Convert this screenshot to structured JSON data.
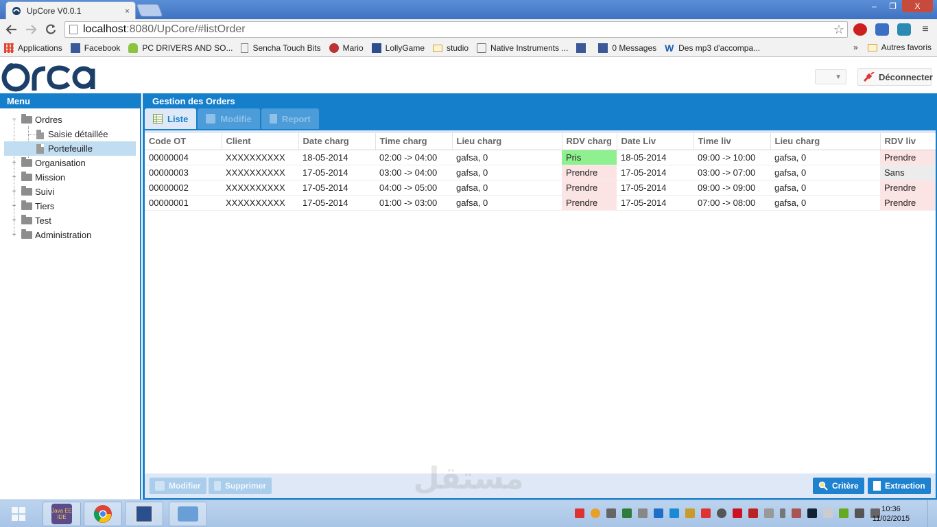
{
  "browser": {
    "tab_title": "UpCore V0.0.1",
    "tab_close": "×",
    "url_host": "localhost",
    "url_rest": ":8080/UpCore/#listOrder",
    "window_controls": [
      "–",
      "❐",
      "X"
    ]
  },
  "bookmarks": {
    "items": [
      {
        "label": "Applications",
        "icon": "apps-grid-icon"
      },
      {
        "label": "Facebook",
        "icon": "facebook-icon"
      },
      {
        "label": "PC DRIVERS AND SO...",
        "icon": "android-icon"
      },
      {
        "label": "Sencha Touch Bits",
        "icon": "page-icon"
      },
      {
        "label": "Mario",
        "icon": "mario-icon"
      },
      {
        "label": "LollyGame",
        "icon": "game-icon"
      },
      {
        "label": "studio",
        "icon": "folder-icon"
      },
      {
        "label": "Native Instruments ...",
        "icon": "speaker-icon"
      },
      {
        "label": "",
        "icon": "facebook-icon"
      },
      {
        "label": "0 Messages",
        "icon": "facebook-icon"
      },
      {
        "label": "Des mp3 d'accompa...",
        "icon": "w-icon"
      }
    ],
    "overflow": "»",
    "other_label": "Autres favoris"
  },
  "header": {
    "logo_text": "orca",
    "logout_label": "Déconnecter",
    "dropdown_arrow": "▼"
  },
  "menu": {
    "title": "Menu",
    "items": [
      {
        "label": "Ordres",
        "expanded": true,
        "children": [
          {
            "label": "Saisie détaillée",
            "selected": false
          },
          {
            "label": "Portefeuille",
            "selected": true
          }
        ]
      },
      {
        "label": "Organisation"
      },
      {
        "label": "Mission"
      },
      {
        "label": "Suivi"
      },
      {
        "label": "Tiers"
      },
      {
        "label": "Test"
      },
      {
        "label": "Administration"
      }
    ]
  },
  "main": {
    "title": "Gestion des Orders",
    "tabs": [
      {
        "label": "Liste",
        "active": true
      },
      {
        "label": "Modifie",
        "active": false
      },
      {
        "label": "Report",
        "active": false
      }
    ],
    "columns": [
      "Code OT",
      "Client",
      "Date charg",
      "Time charg",
      "Lieu charg",
      "RDV charg",
      "Date Liv",
      "Time liv",
      "Lieu charg",
      "RDV liv"
    ],
    "rows": [
      [
        "00000004",
        "XXXXXXXXXX",
        "18-05-2014",
        "02:00 -> 04:00",
        "gafsa, 0",
        "Pris",
        "18-05-2014",
        "09:00 -> 10:00",
        "gafsa, 0",
        "Prendre"
      ],
      [
        "00000003",
        "XXXXXXXXXX",
        "17-05-2014",
        "03:00 -> 04:00",
        "gafsa, 0",
        "Prendre",
        "17-05-2014",
        "03:00 -> 07:00",
        "gafsa, 0",
        "Sans"
      ],
      [
        "00000002",
        "XXXXXXXXXX",
        "17-05-2014",
        "04:00 -> 05:00",
        "gafsa, 0",
        "Prendre",
        "17-05-2014",
        "09:00 -> 09:00",
        "gafsa, 0",
        "Prendre"
      ],
      [
        "00000001",
        "XXXXXXXXXX",
        "17-05-2014",
        "01:00 -> 03:00",
        "gafsa, 0",
        "Prendre",
        "17-05-2014",
        "07:00 -> 08:00",
        "gafsa, 0",
        "Prendre"
      ]
    ],
    "status_colors": {
      "Pris": "#8ef08e",
      "Prendre": "#fde4e4",
      "Sans": "#ececec"
    },
    "buttons": {
      "modifier": "Modifier",
      "supprimer": "Supprimer",
      "critere": "Critère",
      "extraction": "Extraction"
    }
  },
  "watermark": "مستقل",
  "taskbar": {
    "time": "10:36",
    "date": "11/02/2015",
    "java_label": "Java EE IDE"
  }
}
